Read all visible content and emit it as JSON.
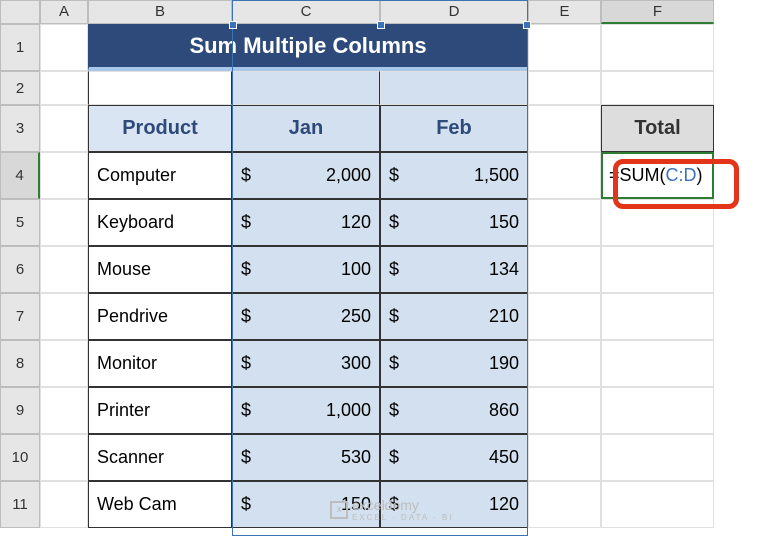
{
  "columns": [
    "A",
    "B",
    "C",
    "D",
    "E",
    "F"
  ],
  "rows": [
    "1",
    "2",
    "3",
    "4",
    "5",
    "6",
    "7",
    "8",
    "9",
    "10",
    "11"
  ],
  "title": "Sum Multiple Columns",
  "headers": {
    "product": "Product",
    "jan": "Jan",
    "feb": "Feb",
    "total": "Total"
  },
  "data": [
    {
      "product": "Computer",
      "jan": "2,000",
      "feb": "1,500"
    },
    {
      "product": "Keyboard",
      "jan": "120",
      "feb": "150"
    },
    {
      "product": "Mouse",
      "jan": "100",
      "feb": "134"
    },
    {
      "product": "Pendrive",
      "jan": "250",
      "feb": "210"
    },
    {
      "product": "Monitor",
      "jan": "300",
      "feb": "190"
    },
    {
      "product": "Printer",
      "jan": "1,000",
      "feb": "860"
    },
    {
      "product": "Scanner",
      "jan": "530",
      "feb": "450"
    },
    {
      "product": "Web Cam",
      "jan": "150",
      "feb": "120"
    }
  ],
  "currency": "$",
  "formula": {
    "prefix": "=SUM(",
    "ref": "C:D",
    "suffix": ")"
  },
  "watermark": {
    "text": "exceldemy",
    "sub": "EXCEL · DATA · BI"
  },
  "chart_data": {
    "type": "table",
    "categories": [
      "Computer",
      "Keyboard",
      "Mouse",
      "Pendrive",
      "Monitor",
      "Printer",
      "Scanner",
      "Web Cam"
    ],
    "series": [
      {
        "name": "Jan",
        "values": [
          2000,
          120,
          100,
          250,
          300,
          1000,
          530,
          150
        ]
      },
      {
        "name": "Feb",
        "values": [
          1500,
          150,
          134,
          210,
          190,
          860,
          450,
          120
        ]
      }
    ],
    "title": "Sum Multiple Columns"
  }
}
